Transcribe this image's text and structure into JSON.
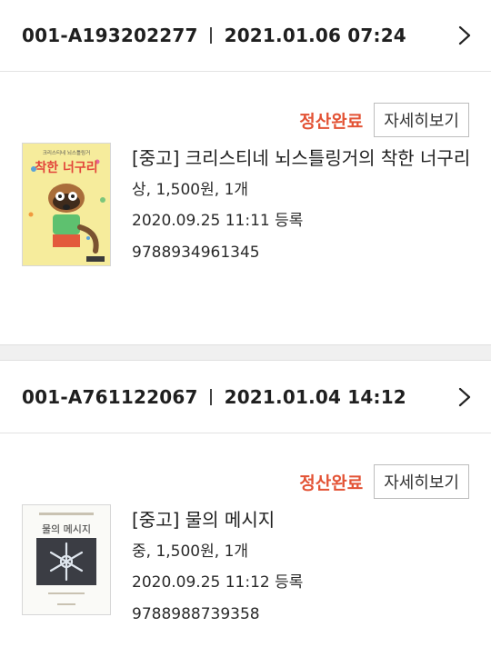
{
  "orders": [
    {
      "order_id": "001-A193202277",
      "order_datetime": "2021.01.06 07:24",
      "status": "정산완료",
      "detail_button": "자세히보기",
      "item": {
        "title": "[중고] 크리스티네 뇌스틀링거의 착한 너구리",
        "condition_price_qty": "상, 1,500원, 1개",
        "registered": "2020.09.25 11:11 등록",
        "isbn": "9788934961345",
        "cover_title": "착한 너구리",
        "cover_subtitle": "크리스티네 뇌스틀링거"
      }
    },
    {
      "order_id": "001-A761122067",
      "order_datetime": "2021.01.04 14:12",
      "status": "정산완료",
      "detail_button": "자세히보기",
      "item": {
        "title": "[중고] 물의 메시지",
        "condition_price_qty": "중, 1,500원, 1개",
        "registered": "2020.09.25 11:12 등록",
        "isbn": "9788988739358",
        "cover_title": "물의 메시지"
      }
    }
  ],
  "colors": {
    "status": "#e35335",
    "divider": "#e3e3e3",
    "section_gap": "#f0f0f0"
  },
  "icons": {
    "order_chevron": "chevron-right-icon"
  }
}
